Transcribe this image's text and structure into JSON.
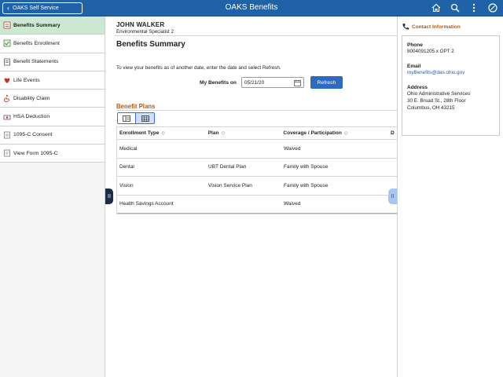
{
  "header": {
    "back_label": "OAKS Self Service",
    "title": "OAKS Benefits",
    "icons": [
      "home-icon",
      "search-icon",
      "more-vertical-icon",
      "navbar-icon"
    ]
  },
  "sidebar": {
    "items": [
      {
        "label": "Benefits Summary",
        "icon": "summary-icon",
        "active": true
      },
      {
        "label": "Benefits Enrollment",
        "icon": "enrollment-icon"
      },
      {
        "label": "Benefit Statements",
        "icon": "statements-icon"
      },
      {
        "label": "Life Events",
        "icon": "life-events-icon"
      },
      {
        "label": "Disability Claim",
        "icon": "disability-icon"
      },
      {
        "label": "HSA Deduction",
        "icon": "hsa-icon"
      },
      {
        "label": "1095-C Consent",
        "icon": "consent-icon"
      },
      {
        "label": "View Form 1095-C",
        "icon": "form-icon"
      }
    ]
  },
  "employee": {
    "name": "JOHN WALKER",
    "title": "Environmental Specialist 2"
  },
  "main": {
    "page_title": "Benefits Summary",
    "instructions": "To view your benefits as of another date, enter the date and select Refresh.",
    "date_label": "My Benefits on",
    "date_value": "05/21/20",
    "refresh_label": "Refresh",
    "section_title": "Benefit Plans"
  },
  "grid": {
    "columns": [
      "Enrollment Type",
      "Plan",
      "Coverage / Participation",
      "D"
    ],
    "rows": [
      {
        "type": "Medical",
        "plan": "",
        "coverage": "Waived"
      },
      {
        "type": "Dental",
        "plan": "UBT Dental Plan",
        "coverage": "Family with Spouse"
      },
      {
        "type": "Vision",
        "plan": "Vision Service Plan",
        "coverage": "Family with Spouse"
      },
      {
        "type": "Health Savings Account",
        "plan": "",
        "coverage": "Waived"
      }
    ]
  },
  "contact": {
    "title": "Contact Information",
    "phone_label": "Phone",
    "phone_value": "8004091205 x OPT 2",
    "email_label": "Email",
    "email_value": "myBenefits@das.ohio.gov",
    "address_label": "Address",
    "address_lines": [
      "Ohio Administrative Services",
      "30 E. Broad St., 28th Floor",
      "Columbus, OH 43215"
    ]
  },
  "colors": {
    "header_bg": "#1f62a7",
    "active_item_bg": "#cde8d1",
    "section_accent": "#b05a18",
    "button_bg": "#2d6bc3"
  }
}
